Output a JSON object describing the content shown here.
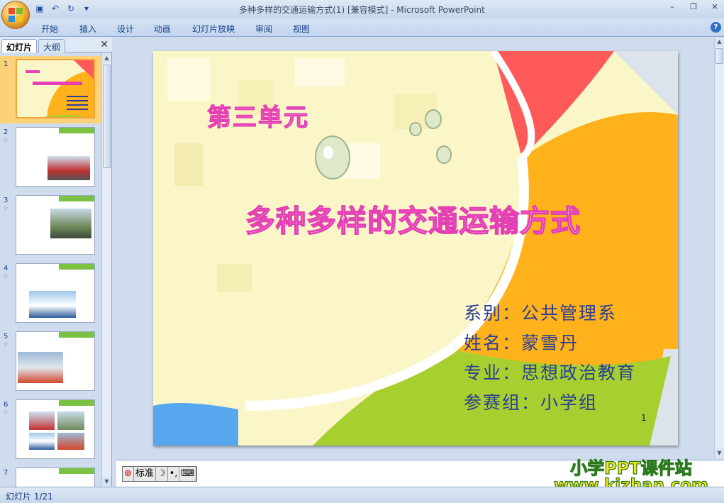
{
  "window": {
    "title": "多种多样的交通运输方式(1) [兼容模式] - Microsoft PowerPoint",
    "minimize": "–",
    "restore": "❐",
    "close": "✕"
  },
  "quick_access": {
    "save_icon": "save-icon",
    "undo_icon": "undo-icon",
    "redo_icon": "redo-icon"
  },
  "ribbon": {
    "tabs": [
      "开始",
      "插入",
      "设计",
      "动画",
      "幻灯片放映",
      "审阅",
      "视图"
    ],
    "help": "?"
  },
  "left_panel": {
    "tab_slides": "幻灯片",
    "tab_outline": "大纲",
    "close": "✕",
    "thumbnails": [
      {
        "num": "1"
      },
      {
        "num": "2"
      },
      {
        "num": "3"
      },
      {
        "num": "4"
      },
      {
        "num": "5"
      },
      {
        "num": "6"
      },
      {
        "num": "7"
      }
    ]
  },
  "slide": {
    "unit_title": "第三单元",
    "main_title": "多种多样的交通运输方式",
    "info": [
      "系别：公共管理系",
      "姓名：蒙雪丹",
      "专业：思想政治教育",
      "参赛组：小学组"
    ],
    "page_number": "1"
  },
  "ime_toolbar": {
    "mode": "标准"
  },
  "status_bar": {
    "slide_indicator": "幻灯片 1/21"
  },
  "watermark": {
    "line1": "小学PPT课件站",
    "line2": "www.kjzhan.com"
  },
  "colors": {
    "ribbon_bg": "#c3d5ee",
    "slide_red": "#ff5a5a",
    "slide_orange": "#ffb21c",
    "slide_green": "#a6cf2f",
    "slide_blue": "#57a7ee",
    "title_pink": "#e43fb4",
    "info_blue": "#2a3f93"
  }
}
